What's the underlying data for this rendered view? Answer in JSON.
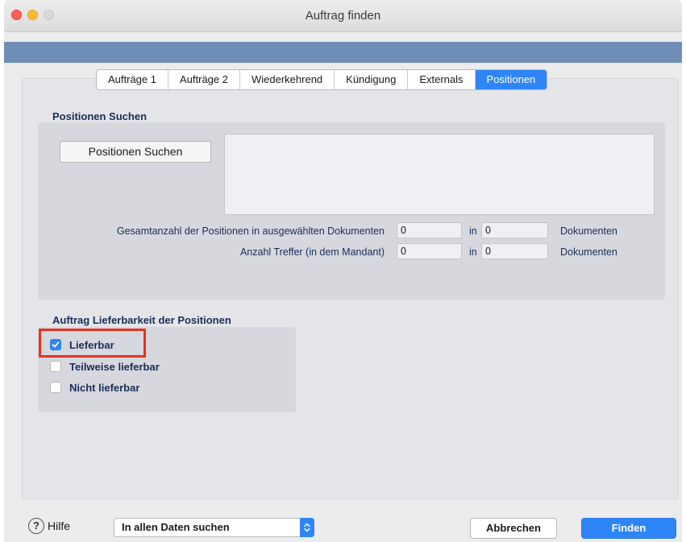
{
  "window": {
    "title": "Auftrag finden"
  },
  "tabs": [
    {
      "label": "Aufträge 1",
      "active": false
    },
    {
      "label": "Aufträge 2",
      "active": false
    },
    {
      "label": "Wiederkehrend",
      "active": false
    },
    {
      "label": "Kündigung",
      "active": false
    },
    {
      "label": "Externals",
      "active": false
    },
    {
      "label": "Positionen",
      "active": true
    }
  ],
  "search_section": {
    "title": "Positionen Suchen",
    "button_label": "Positionen Suchen",
    "rows": [
      {
        "label": "Gesamtanzahl der Positionen in ausgewählten Dokumenten",
        "count": "0",
        "in_label": "in",
        "docs": "0",
        "unit": "Dokumenten"
      },
      {
        "label": "Anzahl Treffer (in dem Mandant)",
        "count": "0",
        "in_label": "in",
        "docs": "0",
        "unit": "Dokumenten"
      }
    ]
  },
  "availability_section": {
    "title": "Auftrag Lieferbarkeit der Positionen",
    "options": [
      {
        "label": "Lieferbar",
        "checked": true
      },
      {
        "label": "Teilweise lieferbar",
        "checked": false
      },
      {
        "label": "Nicht lieferbar",
        "checked": false
      }
    ]
  },
  "footer": {
    "help_label": "Hilfe",
    "help_icon": "question-circle-icon",
    "scope_select": "In allen Daten suchen",
    "cancel_label": "Abbrechen",
    "find_label": "Finden"
  },
  "colors": {
    "accent": "#2e86f6",
    "bluebar": "#6f8eb7",
    "highlight": "#e8321e",
    "label_text": "#1b2d57"
  }
}
